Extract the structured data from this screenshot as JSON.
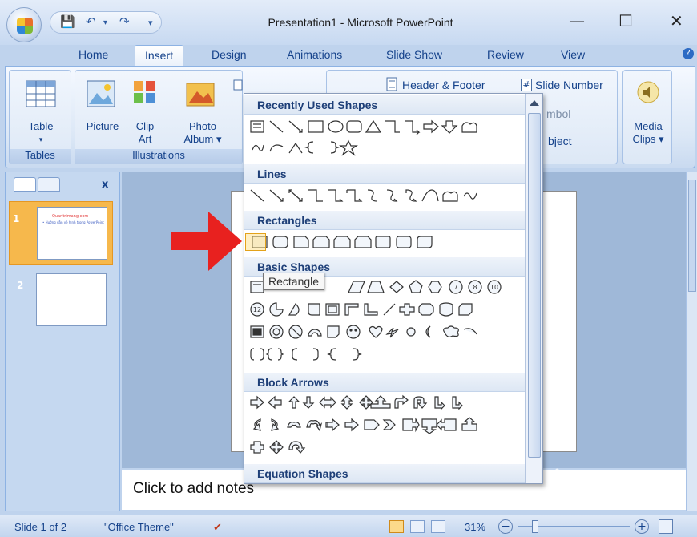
{
  "window": {
    "title": "Presentation1 - Microsoft PowerPoint",
    "minimize": "—",
    "maximize": "☐",
    "close": "✕",
    "qat_dropdown": "▾"
  },
  "tabs": [
    {
      "label": "Home"
    },
    {
      "label": "Insert"
    },
    {
      "label": "Design"
    },
    {
      "label": "Animations"
    },
    {
      "label": "Slide Show"
    },
    {
      "label": "Review"
    },
    {
      "label": "View"
    }
  ],
  "help": "?",
  "ribbon": {
    "table": {
      "label": "Table",
      "arrow": "▾"
    },
    "picture": {
      "label": "Picture"
    },
    "clip_art": {
      "line1": "Clip",
      "line2": "Art"
    },
    "photo_album": {
      "line1": "Photo",
      "line2": "Album ▾"
    },
    "header_footer": "Header & Footer",
    "slide_number": "Slide Number",
    "symbol": "mbol",
    "object": "bject",
    "media_clips": {
      "line1": "Media",
      "line2": "Clips ▾"
    },
    "group_tables": "Tables",
    "group_illustrations": "Illustrations"
  },
  "left_panel": {
    "close": "x",
    "slide1_num": "1",
    "slide2_num": "2",
    "slide1_title": "Quantrimang.com",
    "slide1_body": "• Hướng dẫn vẽ hình trong PowerPoint"
  },
  "shapes_menu": {
    "sections": {
      "recent": "Recently Used Shapes",
      "lines": "Lines",
      "rectangles": "Rectangles",
      "basic": "Basic Shapes",
      "block_arrows": "Block Arrows",
      "equation": "Equation Shapes"
    },
    "tooltip": "Rectangle",
    "basic_numbers": [
      "7",
      "8",
      "10",
      "12"
    ]
  },
  "notes": {
    "placeholder": "Click to add notes"
  },
  "status": {
    "slide": "Slide 1 of 2",
    "theme": "\"Office Theme\"",
    "zoom": "31%",
    "zoom_minus": "−",
    "zoom_plus": "+"
  },
  "watermark": "Quantrimang",
  "colors": {
    "ribbon_text": "#15428b",
    "arrow": "#e8211f",
    "highlight": "#e3a21a"
  }
}
